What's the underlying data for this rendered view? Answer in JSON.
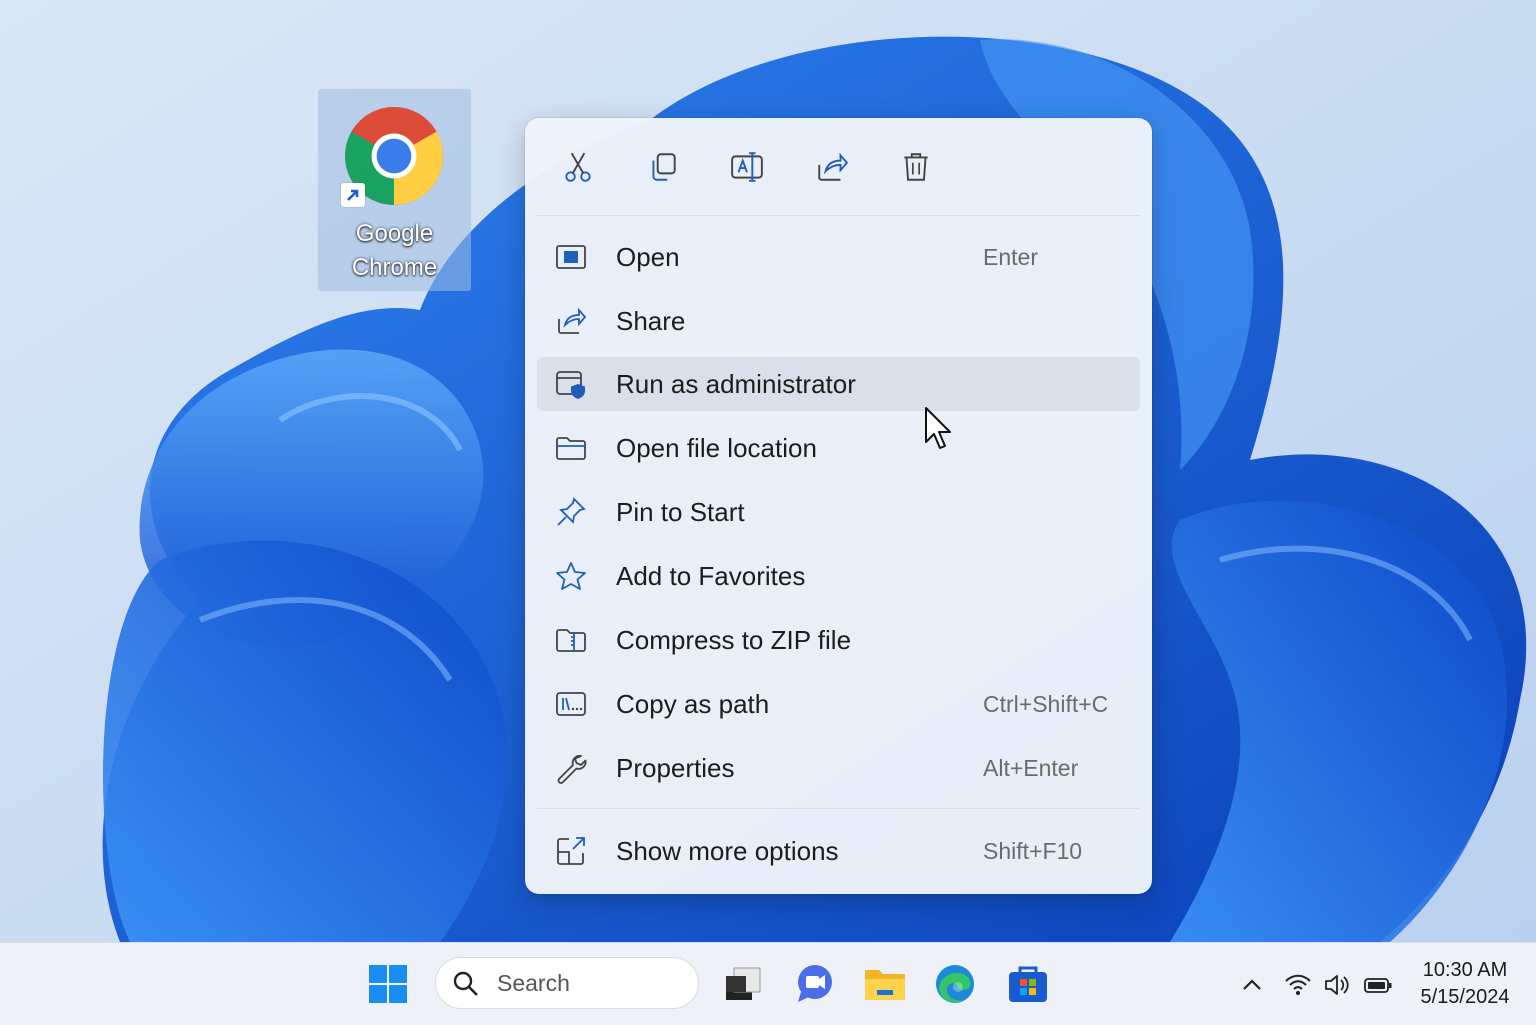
{
  "desktop": {
    "icon_label": "Google\nChrome",
    "icon_label_line1": "Google",
    "icon_label_line2": "Chrome"
  },
  "context_menu": {
    "toolbar": [
      {
        "name": "cut-icon",
        "label": "Cut"
      },
      {
        "name": "copy-icon",
        "label": "Copy"
      },
      {
        "name": "rename-icon",
        "label": "Rename"
      },
      {
        "name": "share-icon",
        "label": "Share"
      },
      {
        "name": "delete-icon",
        "label": "Delete"
      }
    ],
    "items": [
      {
        "label": "Open",
        "shortcut": "Enter",
        "icon": "open-window-icon"
      },
      {
        "label": "Share",
        "shortcut": "",
        "icon": "share-icon"
      },
      {
        "label": "Run as administrator",
        "shortcut": "",
        "icon": "admin-shield-icon",
        "hovered": true
      },
      {
        "label": "Open file location",
        "shortcut": "",
        "icon": "folder-icon"
      },
      {
        "label": "Pin to Start",
        "shortcut": "",
        "icon": "pin-icon"
      },
      {
        "label": "Add to Favorites",
        "shortcut": "",
        "icon": "star-icon"
      },
      {
        "label": "Compress to ZIP file",
        "shortcut": "",
        "icon": "zip-folder-icon"
      },
      {
        "label": "Copy as path",
        "shortcut": "Ctrl+Shift+C",
        "icon": "copy-path-icon"
      },
      {
        "label": "Properties",
        "shortcut": "Alt+Enter",
        "icon": "wrench-icon"
      }
    ],
    "more": {
      "label": "Show more options",
      "shortcut": "Shift+F10",
      "icon": "expand-icon"
    }
  },
  "taskbar": {
    "search_placeholder": "Search",
    "apps": [
      "start-icon",
      "task-view-icon",
      "teams-chat-icon",
      "file-explorer-icon",
      "edge-icon",
      "store-icon"
    ],
    "tray": [
      "chevron-up-icon",
      "wifi-icon",
      "volume-icon",
      "battery-icon"
    ],
    "time": "10:30 AM",
    "date": "5/15/2024"
  },
  "colors": {
    "accent": "#0a5fd6",
    "menu_bg": "#f0f4fa",
    "hover_bg": "#dde1e9",
    "icon_blue": "#1f5fb8"
  }
}
